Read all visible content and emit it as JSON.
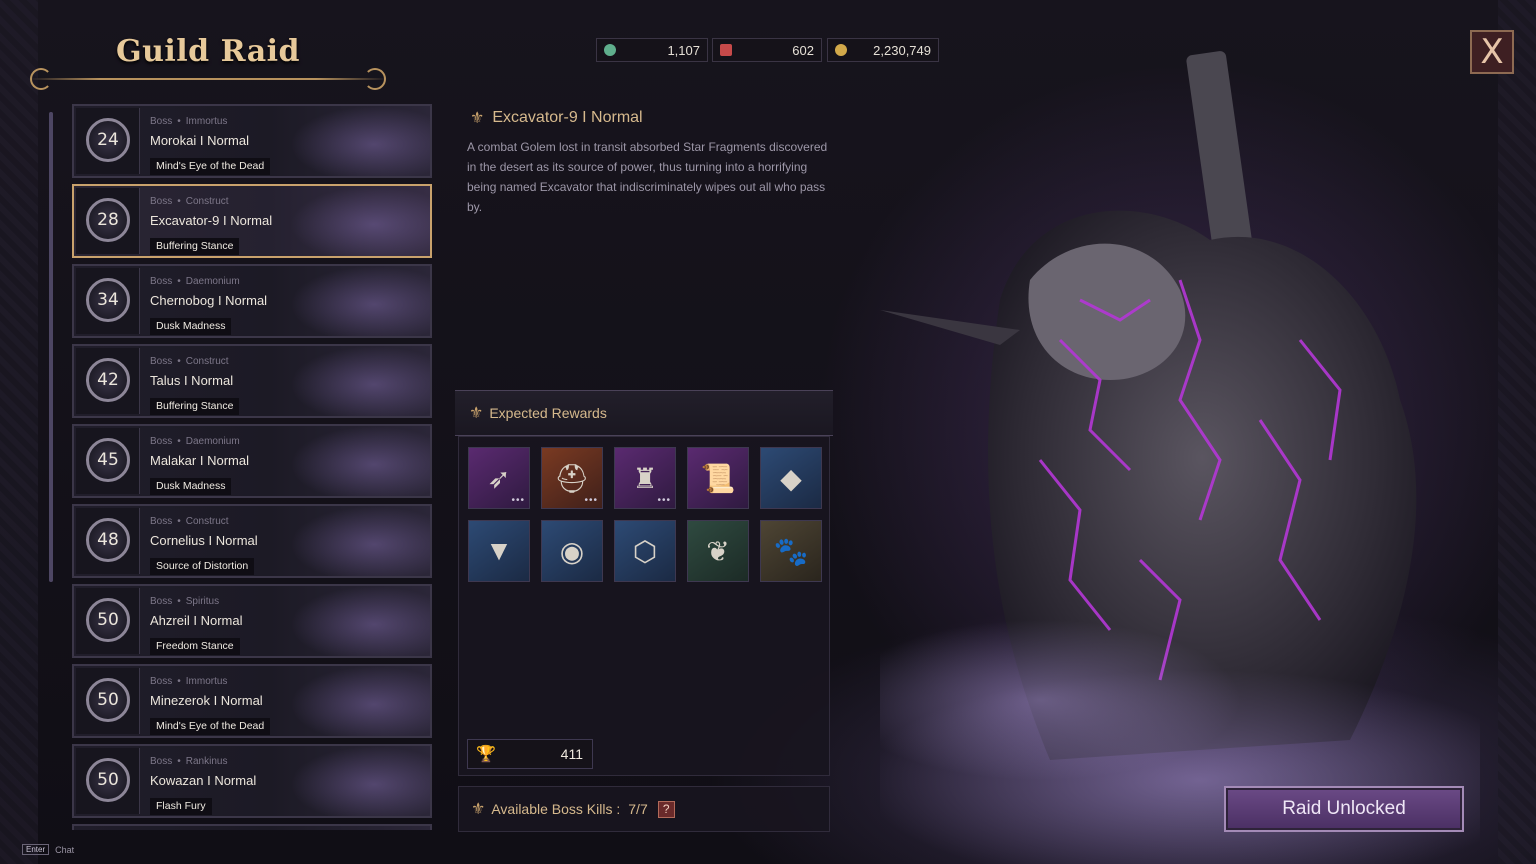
{
  "window": {
    "title": "Guild Raid"
  },
  "currencies": [
    {
      "icon": "green-gem-icon",
      "value": "1,107",
      "color": "#5fae8c"
    },
    {
      "icon": "red-gem-icon",
      "value": "602",
      "color": "#c74a4a"
    },
    {
      "icon": "gold-coin-icon",
      "value": "2,230,749",
      "color": "#d2a94a"
    }
  ],
  "close": {
    "label": "X"
  },
  "bosses": [
    {
      "level": "24",
      "type": "Boss",
      "race": "Immortus",
      "name": "Morokai I Normal",
      "stance": "Mind's Eye of the Dead",
      "selected": false
    },
    {
      "level": "28",
      "type": "Boss",
      "race": "Construct",
      "name": "Excavator-9 I Normal",
      "stance": "Buffering Stance",
      "selected": true
    },
    {
      "level": "34",
      "type": "Boss",
      "race": "Daemonium",
      "name": "Chernobog I Normal",
      "stance": "Dusk Madness",
      "selected": false
    },
    {
      "level": "42",
      "type": "Boss",
      "race": "Construct",
      "name": "Talus I Normal",
      "stance": "Buffering Stance",
      "selected": false
    },
    {
      "level": "45",
      "type": "Boss",
      "race": "Daemonium",
      "name": "Malakar I Normal",
      "stance": "Dusk Madness",
      "selected": false
    },
    {
      "level": "48",
      "type": "Boss",
      "race": "Construct",
      "name": "Cornelius I Normal",
      "stance": "Source of Distortion",
      "selected": false
    },
    {
      "level": "50",
      "type": "Boss",
      "race": "Spiritus",
      "name": "Ahzreil I Normal",
      "stance": "Freedom Stance",
      "selected": false
    },
    {
      "level": "50",
      "type": "Boss",
      "race": "Immortus",
      "name": "Minezerok I Normal",
      "stance": "Mind's Eye of the Dead",
      "selected": false
    },
    {
      "level": "50",
      "type": "Boss",
      "race": "Rankinus",
      "name": "Kowazan I Normal",
      "stance": "Flash Fury",
      "selected": false
    }
  ],
  "detail": {
    "title": "Excavator-9 I Normal",
    "description": "A combat Golem lost in transit absorbed Star Fragments discovered in the desert as its source of power, thus turning into a horrifying being named Excavator that indiscriminately wipes out all who pass by."
  },
  "rewards": {
    "header": "Expected Rewards",
    "items": [
      {
        "icon": "crossbow-icon",
        "glyph": "➶",
        "quality": "purple",
        "more": true
      },
      {
        "icon": "helmet-icon",
        "glyph": "⛑",
        "quality": "orange",
        "more": true
      },
      {
        "icon": "armor-icon",
        "glyph": "♜",
        "quality": "purple",
        "more": true
      },
      {
        "icon": "scroll-icon",
        "glyph": "📜",
        "quality": "purple",
        "more": false
      },
      {
        "icon": "orange-crystal-icon",
        "glyph": "◆",
        "quality": "blue",
        "more": false
      },
      {
        "icon": "gold-triangle-icon",
        "glyph": "▼",
        "quality": "blue",
        "more": false
      },
      {
        "icon": "blue-orb-icon",
        "glyph": "◉",
        "quality": "blue",
        "more": false
      },
      {
        "icon": "silver-gear-icon",
        "glyph": "⬡",
        "quality": "blue",
        "more": false
      },
      {
        "icon": "green-leaf-card-icon",
        "glyph": "❦",
        "quality": "green",
        "more": false
      },
      {
        "icon": "paw-bird-icon",
        "glyph": "🐾",
        "quality": "brown",
        "more": false
      }
    ],
    "contribution": "411"
  },
  "kills": {
    "label": "Available Boss Kills :",
    "value": "7/7",
    "help": "?"
  },
  "action": {
    "label": "Raid Unlocked"
  },
  "chat": {
    "key": "Enter",
    "label": "Chat"
  }
}
